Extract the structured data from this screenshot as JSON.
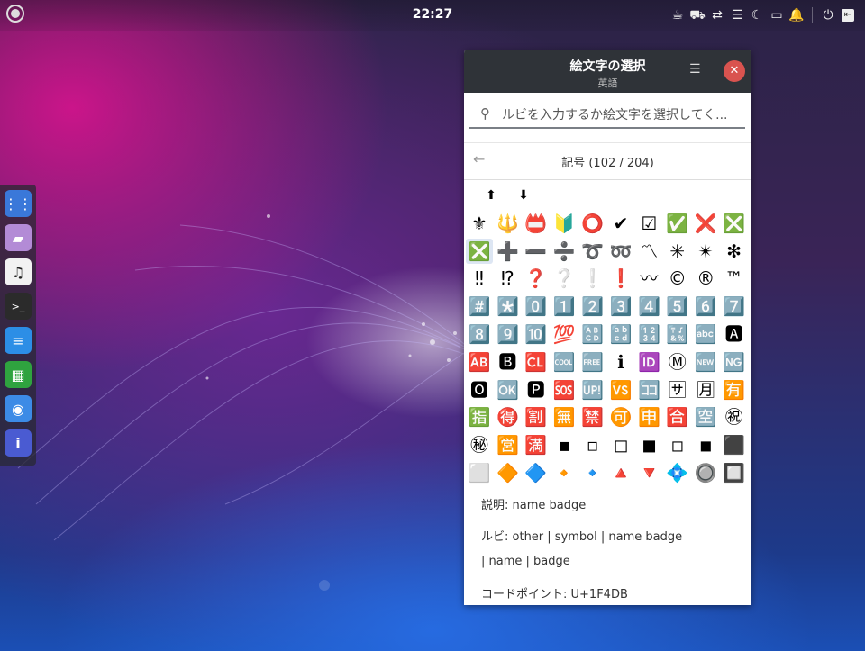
{
  "topbar": {
    "clock": "22:27",
    "tray_icons": [
      "coffee-icon",
      "network-icon",
      "transfer-icon",
      "menu-icon",
      "moon-icon",
      "folder-icon",
      "notification-icon",
      "power-icon",
      "logout-icon"
    ]
  },
  "dock": {
    "items": [
      {
        "name": "apps-grid",
        "color": "#3a78d9",
        "glyph": "⋮⋮"
      },
      {
        "name": "files",
        "color": "#b38bd6",
        "glyph": "📁"
      },
      {
        "name": "music",
        "color": "#f2f2f2",
        "glyph": "♫"
      },
      {
        "name": "terminal",
        "color": "#2b2b2b",
        "glyph": ">_"
      },
      {
        "name": "text-editor",
        "color": "#2c8ee6",
        "glyph": "≡"
      },
      {
        "name": "spreadsheet",
        "color": "#2fa33f",
        "glyph": "▦"
      },
      {
        "name": "browser",
        "color": "#3c8be6",
        "glyph": "◉"
      },
      {
        "name": "info",
        "color": "#4a5bd2",
        "glyph": "i"
      }
    ]
  },
  "window": {
    "title": "絵文字の選択",
    "subtitle": "英語",
    "search_placeholder": "ルビを入力するか絵文字を選択してく...",
    "category_title": "記号 (102 / 204)",
    "emojis": [
      [
        "⬆",
        "⬇"
      ],
      [
        "⚜",
        "🔱",
        "📛",
        "🔰",
        "⭕",
        "✔",
        "☑",
        "✅",
        "❌",
        "❎"
      ],
      [
        "❎",
        "➕",
        "➖",
        "➗",
        "➰",
        "➿",
        "〽",
        "✳",
        "✴",
        "❇"
      ],
      [
        "‼",
        "⁉",
        "❓",
        "❔",
        "❕",
        "❗",
        "〰",
        "©",
        "®",
        "™"
      ],
      [
        "#️⃣",
        "*️⃣",
        "0️⃣",
        "1️⃣",
        "2️⃣",
        "3️⃣",
        "4️⃣",
        "5️⃣",
        "6️⃣",
        "7️⃣"
      ],
      [
        "8️⃣",
        "9️⃣",
        "🔟",
        "💯",
        "🔠",
        "🔡",
        "🔢",
        "🔣",
        "🔤",
        "🅰"
      ],
      [
        "🆎",
        "🅱",
        "🆑",
        "🆒",
        "🆓",
        "ℹ",
        "🆔",
        "Ⓜ",
        "🆕",
        "🆖"
      ],
      [
        "🅾",
        "🆗",
        "🅿",
        "🆘",
        "🆙",
        "🆚",
        "🈁",
        "🈂",
        "🈷",
        "🈶"
      ],
      [
        "🈯",
        "🉐",
        "🈹",
        "🈚",
        "🈲",
        "🉑",
        "🈸",
        "🈴",
        "🈳",
        "㊗"
      ],
      [
        "㊙",
        "🈺",
        "🈵",
        "▪",
        "▫",
        "◻",
        "◼",
        "◽",
        "◾",
        "⬛"
      ],
      [
        "⬜",
        "🔶",
        "🔷",
        "🔸",
        "🔹",
        "🔺",
        "🔻",
        "💠",
        "🔘",
        "🔲"
      ]
    ],
    "selected_emoji": {
      "row": 2,
      "col": 0
    },
    "info": {
      "description": "説明: name badge",
      "ruby_line1": "ルビ: other | symbol | name badge",
      "ruby_line2": " | name | badge",
      "codepoint": "コードポイント: U+1F4DB"
    }
  }
}
